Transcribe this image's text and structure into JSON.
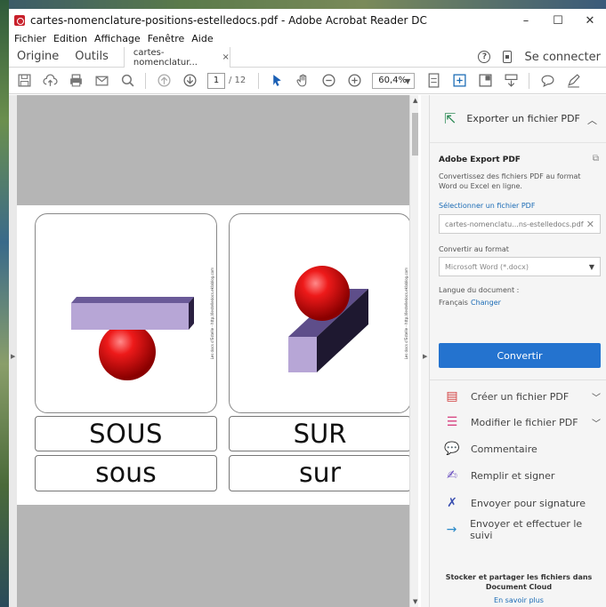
{
  "window": {
    "title": "cartes-nomenclature-positions-estelledocs.pdf - Adobe Acrobat Reader DC",
    "minimize": "–",
    "maximize": "☐",
    "close": "✕"
  },
  "menu": [
    "Fichier",
    "Edition",
    "Affichage",
    "Fenêtre",
    "Aide"
  ],
  "tabs": {
    "home": "Origine",
    "tools": "Outils",
    "document": "cartes-nomenclatur...",
    "document_close": "×",
    "help": "?",
    "signin": "Se connecter"
  },
  "toolbar": {
    "page_current": "1",
    "page_total": "/ 12",
    "zoom": "60,4%"
  },
  "document": {
    "cards": [
      {
        "word_upper": "SOUS",
        "word_lower": "sous",
        "credit": "Les docs d'Estelle - http://lestelledocs.eklablog.com"
      },
      {
        "word_upper": "SUR",
        "word_lower": "sur",
        "credit": "Les docs d'Estelle - http://lestelledocs.eklablog.com"
      }
    ]
  },
  "panel": {
    "export_title": "Exporter un fichier PDF",
    "section_title": "Adobe Export PDF",
    "description": "Convertissez des fichiers PDF au format Word ou Excel en ligne.",
    "select_link": "Sélectionner un fichier PDF",
    "file_name": "cartes-nomenclatu...ns-estelledocs.pdf",
    "convert_label": "Convertir au format",
    "format_value": "Microsoft Word (*.docx)",
    "language_label": "Langue du document :",
    "language_value": "Français",
    "language_change": "Changer",
    "convert_button": "Convertir",
    "tools": [
      {
        "label": "Créer un fichier PDF",
        "icon": "create-pdf-icon"
      },
      {
        "label": "Modifier le fichier PDF",
        "icon": "edit-pdf-icon"
      },
      {
        "label": "Commentaire",
        "icon": "comment-icon"
      },
      {
        "label": "Remplir et signer",
        "icon": "fill-sign-icon"
      },
      {
        "label": "Envoyer pour signature",
        "icon": "send-signature-icon"
      },
      {
        "label": "Envoyer et effectuer le suivi",
        "icon": "send-track-icon"
      }
    ],
    "cloud_text": "Stocker et partager les fichiers dans Document Cloud",
    "learn_more": "En savoir plus"
  },
  "colors": {
    "accent": "#2473cf",
    "acrobat_red": "#c8202b",
    "export_green": "#2e8b57",
    "sphere": "#e01010",
    "bar_top": "#7b6ba8",
    "bar_front": "#b9a8d8"
  }
}
